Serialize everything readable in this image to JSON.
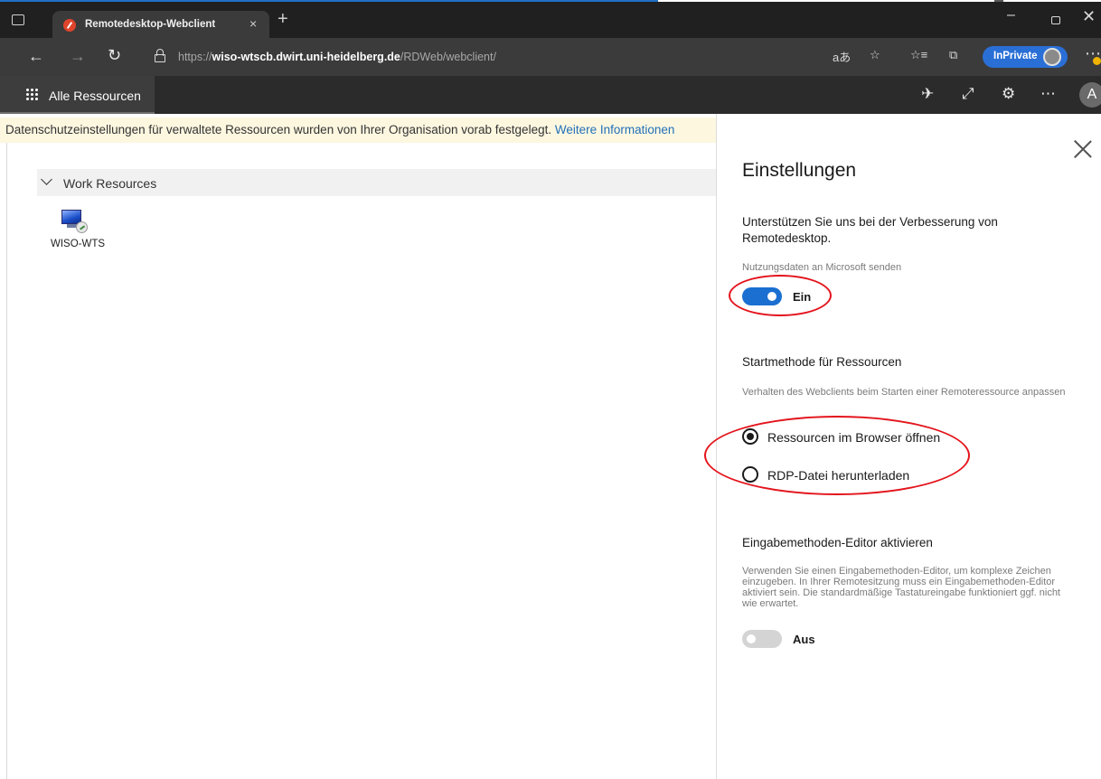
{
  "browser": {
    "tab_title": "Remotedesktop-Webclient",
    "tab_close": "×",
    "new_tab": "+",
    "url_proto": "https://",
    "url_host": "wiso-wtscb.dwirt.uni-heidelberg.de",
    "url_path": "/RDWeb/webclient/",
    "inprivate_label": "InPrivate",
    "window_minimize": "–",
    "window_close": "✕",
    "more": "⋯"
  },
  "app": {
    "nav_label": "Alle Ressourcen",
    "user_initial": "A"
  },
  "notice": {
    "text": "Datenschutzeinstellungen für verwaltete Ressourcen wurden von Ihrer Organisation vorab festgelegt. ",
    "link": "Weitere Informationen"
  },
  "resources": {
    "group_label": "Work Resources",
    "items": [
      {
        "label": "WISO-WTS"
      }
    ]
  },
  "settings": {
    "title": "Einstellungen",
    "telemetry": {
      "heading": "Unterstützen Sie uns bei der Verbesserung von Remotedesktop.",
      "description": "Nutzungsdaten an Microsoft senden",
      "toggle_label": "Ein",
      "enabled": true
    },
    "launch": {
      "heading": "Startmethode für Ressourcen",
      "description": "Verhalten des Webclients beim Starten einer Remoteressource anpassen",
      "options": [
        {
          "label": "Ressourcen im Browser öffnen",
          "selected": true
        },
        {
          "label": "RDP-Datei herunterladen",
          "selected": false
        }
      ]
    },
    "ime": {
      "heading": "Eingabemethoden-Editor aktivieren",
      "description": "Verwenden Sie einen Eingabemethoden-Editor, um komplexe Zeichen einzugeben. In Ihrer Remotesitzung muss ein Eingabemethoden-Editor aktiviert sein. Die standardmäßige Tastatureingabe funktioniert ggf. nicht wie erwartet.",
      "toggle_label": "Aus",
      "enabled": false
    }
  },
  "colors": {
    "accent": "#1a6fd1",
    "annotation": "#e3141c",
    "notice_bg": "#fdf7e0",
    "link": "#2270b8"
  }
}
